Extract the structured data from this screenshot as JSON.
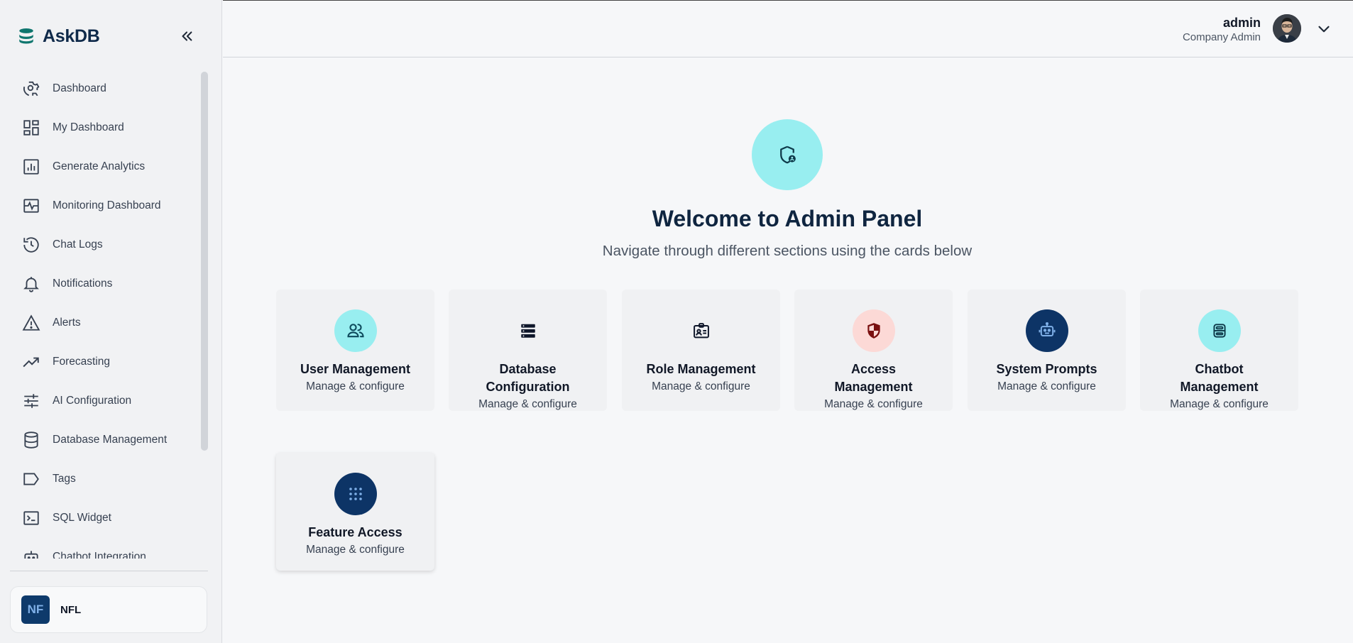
{
  "brand": {
    "name": "AskDB"
  },
  "sidebar": {
    "items": [
      {
        "label": "Dashboard",
        "icon": "dashboard-gear-icon"
      },
      {
        "label": "My Dashboard",
        "icon": "grid-layout-icon"
      },
      {
        "label": "Generate Analytics",
        "icon": "bar-chart-icon"
      },
      {
        "label": "Monitoring Dashboard",
        "icon": "monitoring-pulse-icon"
      },
      {
        "label": "Chat Logs",
        "icon": "history-icon"
      },
      {
        "label": "Notifications",
        "icon": "bell-icon"
      },
      {
        "label": "Alerts",
        "icon": "warning-triangle-icon"
      },
      {
        "label": "Forecasting",
        "icon": "trend-up-icon"
      },
      {
        "label": "AI Configuration",
        "icon": "sliders-icon"
      },
      {
        "label": "Database Management",
        "icon": "database-icon"
      },
      {
        "label": "Tags",
        "icon": "tag-icon"
      },
      {
        "label": "SQL Widget",
        "icon": "terminal-icon"
      },
      {
        "label": "Chatbot Integration",
        "icon": "chatbot-icon"
      }
    ],
    "org": {
      "initials": "NF",
      "name": "NFL"
    }
  },
  "header": {
    "user_name": "admin",
    "user_role": "Company Admin"
  },
  "main": {
    "title": "Welcome to Admin Panel",
    "subtitle": "Navigate through different sections using the cards below",
    "cards": [
      {
        "title": "User Management",
        "subtitle": "Manage & configure",
        "icon": "users-icon",
        "icon_bg": "#98eef0"
      },
      {
        "title": "Database Configuration",
        "subtitle": "Manage & configure",
        "icon": "server-stack-icon",
        "icon_bg": "#f0f1f3"
      },
      {
        "title": "Role Management",
        "subtitle": "Manage & configure",
        "icon": "id-badge-icon",
        "icon_bg": "#f0f1f3"
      },
      {
        "title": "Access Management",
        "subtitle": "Manage & configure",
        "icon": "shield-icon",
        "icon_bg": "#fcd9d6"
      },
      {
        "title": "System Prompts",
        "subtitle": "Manage & configure",
        "icon": "robot-icon",
        "icon_bg": "#0d3466"
      },
      {
        "title": "Chatbot Management",
        "subtitle": "Manage & configure",
        "icon": "bot-icon",
        "icon_bg": "#98eef0"
      },
      {
        "title": "Feature Access",
        "subtitle": "Manage & configure",
        "icon": "dots-grid-icon",
        "icon_bg": "#0d3466"
      }
    ]
  },
  "colors": {
    "brand": "#0f2a4a",
    "accent_teal": "#98eef0",
    "navy": "#0d3466",
    "danger_soft": "#fcd9d6"
  }
}
